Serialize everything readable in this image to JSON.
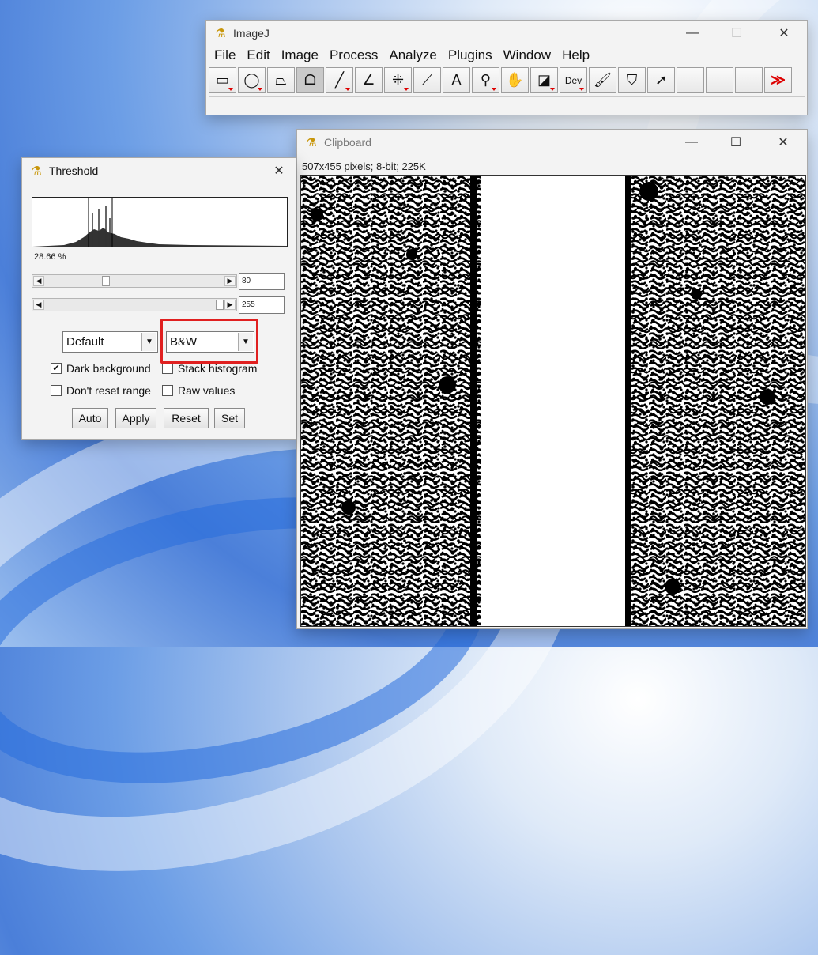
{
  "imagej": {
    "title": "ImageJ",
    "menu": [
      "File",
      "Edit",
      "Image",
      "Process",
      "Analyze",
      "Plugins",
      "Window",
      "Help"
    ],
    "tools": [
      {
        "name": "rectangle-tool-icon",
        "glyph": "▭",
        "menu": true
      },
      {
        "name": "oval-tool-icon",
        "glyph": "◯",
        "menu": true
      },
      {
        "name": "polygon-tool-icon",
        "glyph": "⏢",
        "menu": false
      },
      {
        "name": "freehand-tool-icon",
        "glyph": "ᗝ",
        "menu": false,
        "active": true
      },
      {
        "name": "line-tool-icon",
        "glyph": "╱",
        "menu": true
      },
      {
        "name": "angle-tool-icon",
        "glyph": "∠",
        "menu": false
      },
      {
        "name": "point-tool-icon",
        "glyph": "⁜",
        "menu": true
      },
      {
        "name": "wand-tool-icon",
        "glyph": "⟋",
        "menu": false
      },
      {
        "name": "text-tool-icon",
        "glyph": "A",
        "menu": false
      },
      {
        "name": "magnifier-tool-icon",
        "glyph": "⚲",
        "menu": true
      },
      {
        "name": "scroll-tool-icon",
        "glyph": "✋",
        "menu": false
      },
      {
        "name": "color-picker-tool-icon",
        "glyph": "◪",
        "menu": true
      },
      {
        "name": "developer-menu-icon",
        "glyph": "Dev",
        "menu": true
      },
      {
        "name": "brush-tool-icon",
        "glyph": "🖌",
        "menu": false
      },
      {
        "name": "flood-fill-tool-icon",
        "glyph": "⛉",
        "menu": false
      },
      {
        "name": "arrow-tool-icon",
        "glyph": "➚",
        "menu": false
      },
      {
        "name": "empty-slot-icon",
        "glyph": "",
        "menu": false
      },
      {
        "name": "empty-slot-icon",
        "glyph": "",
        "menu": false
      },
      {
        "name": "empty-slot-icon",
        "glyph": "",
        "menu": false
      },
      {
        "name": "more-tools-icon",
        "glyph": "≫",
        "menu": false
      }
    ]
  },
  "clipboard": {
    "title": "Clipboard",
    "info": "507x455 pixels; 8-bit; 225K"
  },
  "threshold": {
    "title": "Threshold",
    "percent": "28.66 %",
    "min_value": "80",
    "max_value": "255",
    "method": "Default",
    "mode": "B&W",
    "dark_background": "Dark background",
    "stack_histogram": "Stack histogram",
    "dont_reset": "Don't reset range",
    "raw_values": "Raw values",
    "buttons": {
      "auto": "Auto",
      "apply": "Apply",
      "reset": "Reset",
      "set": "Set"
    }
  },
  "colors": {
    "highlight": "#e02020",
    "accent_icon": "#c8960a"
  }
}
